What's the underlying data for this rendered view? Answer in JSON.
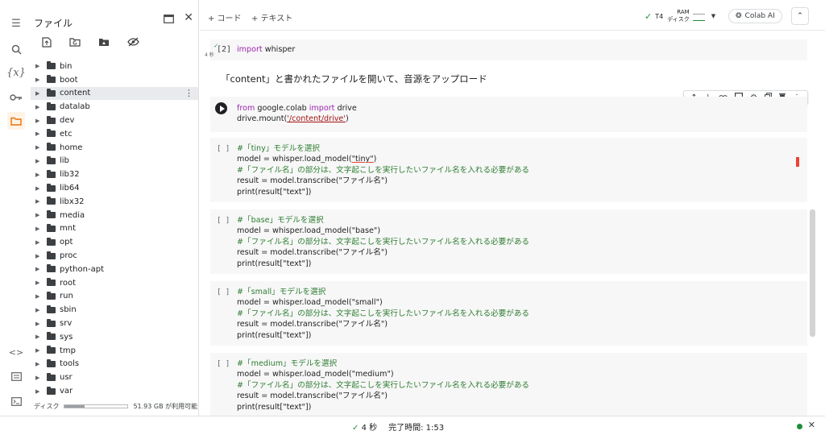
{
  "rail": {
    "icons": [
      "menu-icon",
      "search-icon",
      "variables-icon",
      "key-icon",
      "folder-icon",
      "code-snippets-icon",
      "terminal-list-icon",
      "terminal-icon"
    ],
    "variables_label": "{x}",
    "code_label": "<>"
  },
  "files": {
    "title": "ファイル",
    "items": [
      {
        "name": "bin"
      },
      {
        "name": "boot"
      },
      {
        "name": "content"
      },
      {
        "name": "datalab"
      },
      {
        "name": "dev"
      },
      {
        "name": "etc"
      },
      {
        "name": "home"
      },
      {
        "name": "lib"
      },
      {
        "name": "lib32"
      },
      {
        "name": "lib64"
      },
      {
        "name": "libx32"
      },
      {
        "name": "media"
      },
      {
        "name": "mnt"
      },
      {
        "name": "opt"
      },
      {
        "name": "proc"
      },
      {
        "name": "python-apt"
      },
      {
        "name": "root"
      },
      {
        "name": "run"
      },
      {
        "name": "sbin"
      },
      {
        "name": "srv"
      },
      {
        "name": "sys"
      },
      {
        "name": "tmp"
      },
      {
        "name": "tools"
      },
      {
        "name": "usr"
      },
      {
        "name": "var"
      }
    ],
    "selected": "content",
    "disk_label": "ディスク",
    "disk_free": "51.93 GB が利用可能",
    "disk_used_fraction": 0.32
  },
  "topbar": {
    "add_code": "+ コード",
    "add_text": "+ テキスト",
    "gpu": "T4",
    "ram_label": "RAM",
    "disk_label": "ディスク",
    "colab_ai": "Colab AI"
  },
  "cells": {
    "c1": {
      "exec": "[2]",
      "time": "4 秒",
      "kw": "import",
      "rest": " whisper"
    },
    "text": "「content」と書かれたファイルを開いて、音源をアップロード",
    "c2": {
      "l1_kw1": "from",
      "l1_mod": " google.colab ",
      "l1_kw2": "import",
      "l1_rest": " drive",
      "l2_pre": "drive.mount(",
      "l2_str": "'/content/drive'",
      "l2_post": ")"
    },
    "c3": {
      "bracket": "[ ]",
      "l1": "#「tiny」モデルを選択",
      "l2_pre": "model = whisper.load_model(",
      "l2_str": "\"tiny\"",
      "l2_post": ")",
      "l3": "#「ファイル名」の部分は、文字起こしを実行したいファイル名を入れる必要がある",
      "l4": "result = model.transcribe(\"ファイル名\")",
      "l5": "print(result[\"text\"])"
    },
    "c4": {
      "bracket": "[ ]",
      "l1": "#「base」モデルを選択",
      "l2": "model = whisper.load_model(\"base\")",
      "l3": "#「ファイル名」の部分は、文字起こしを実行したいファイル名を入れる必要がある",
      "l4": "result = model.transcribe(\"ファイル名\")",
      "l5": "print(result[\"text\"])"
    },
    "c5": {
      "bracket": "[ ]",
      "l1": "#「small」モデルを選択",
      "l2": "model = whisper.load_model(\"small\")",
      "l3": "#「ファイル名」の部分は、文字起こしを実行したいファイル名を入れる必要がある",
      "l4": "result = model.transcribe(\"ファイル名\")",
      "l5": "print(result[\"text\"])"
    },
    "c6": {
      "bracket": "[ ]",
      "l1": "#「medium」モデルを選択",
      "l2": "model = whisper.load_model(\"medium\")",
      "l3": "#「ファイル名」の部分は、文字起こしを実行したいファイル名を入れる必要がある",
      "l4": "result = model.transcribe(\"ファイル名\")",
      "l5": "print(result[\"text\"])"
    }
  },
  "status": {
    "time": "4 秒",
    "done": "完了時間: 1:53"
  }
}
